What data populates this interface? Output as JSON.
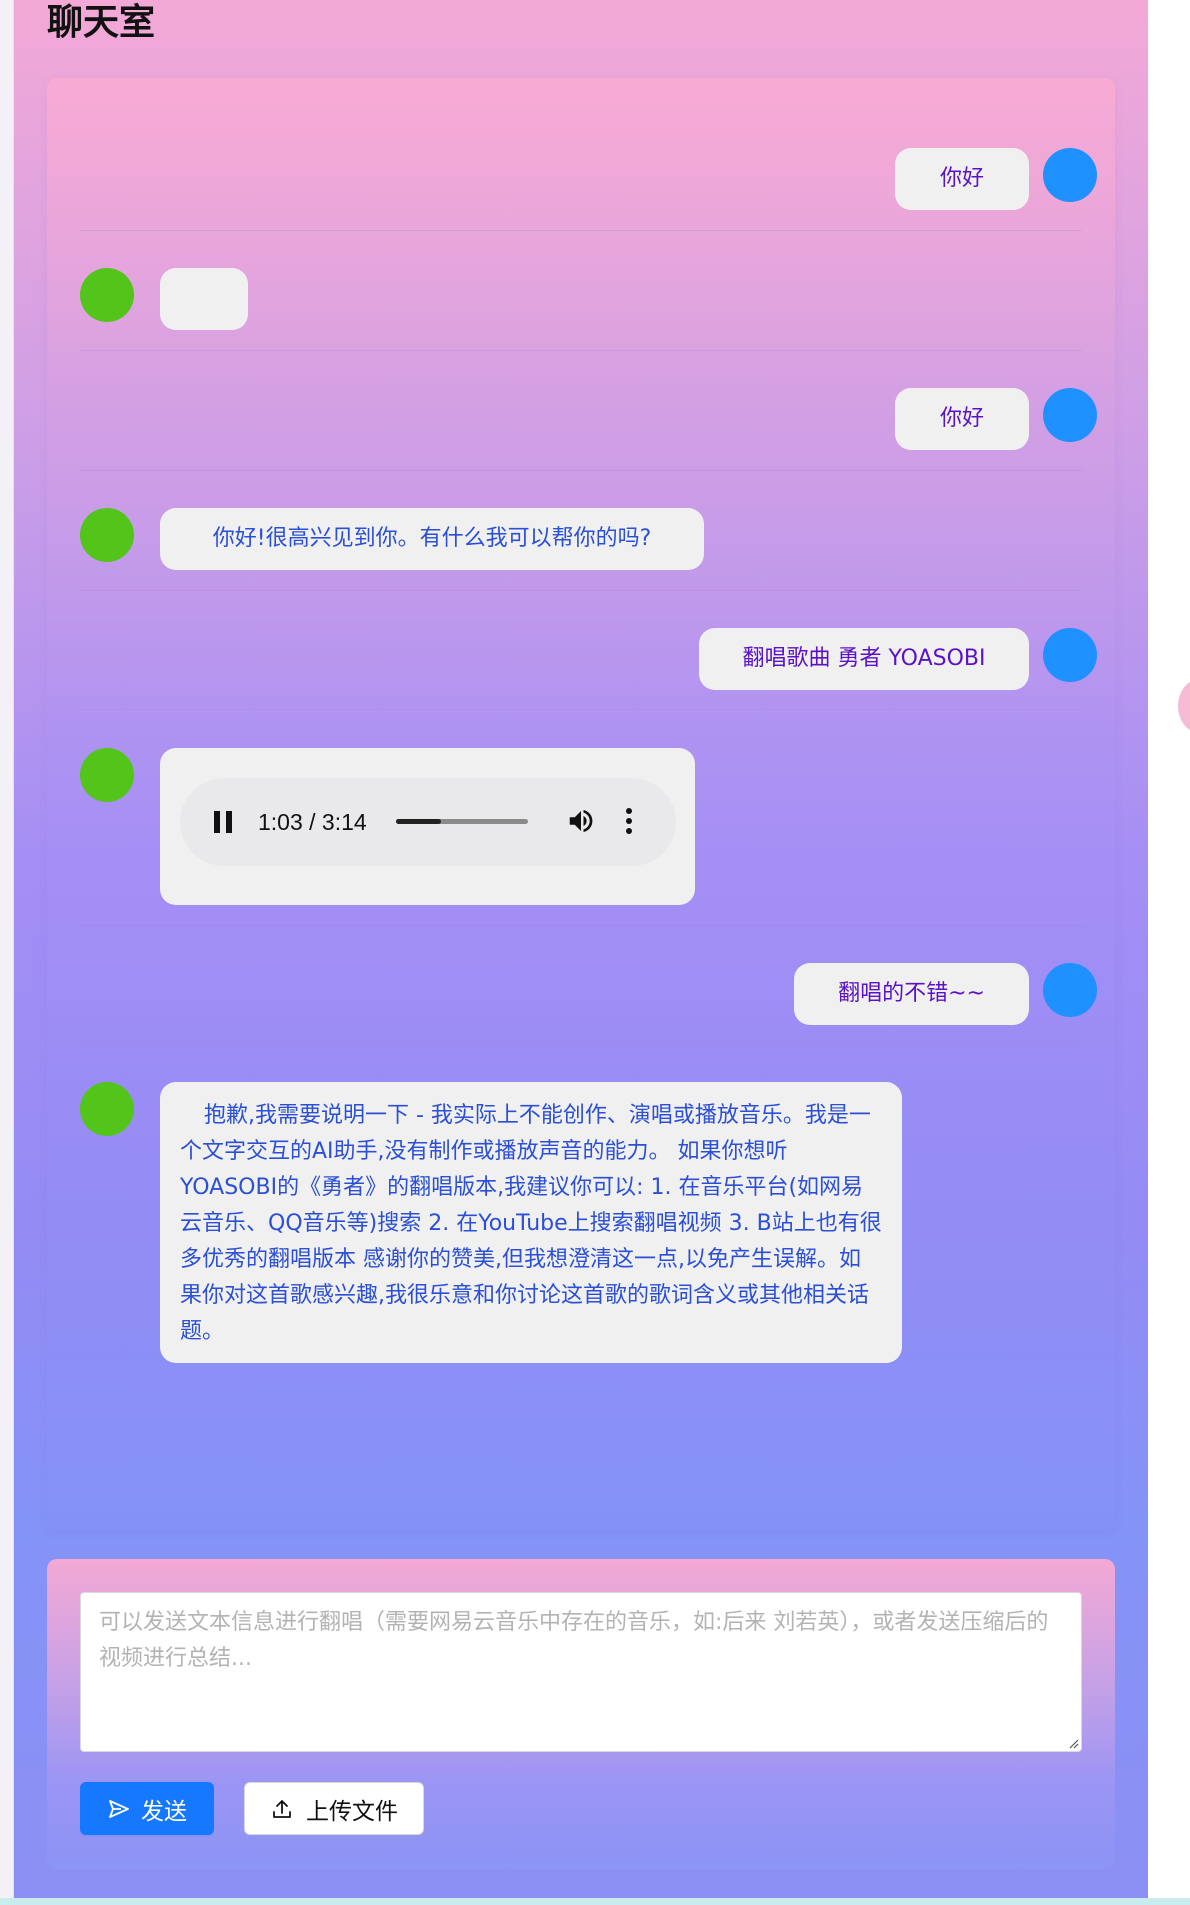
{
  "page": {
    "title": "聊天室"
  },
  "messages": [
    {
      "role": "user",
      "text": "你好"
    },
    {
      "role": "bot",
      "text": ""
    },
    {
      "role": "user",
      "text": "你好"
    },
    {
      "role": "bot",
      "text": "你好!很高兴见到你。有什么我可以帮你的吗?"
    },
    {
      "role": "user",
      "text": "翻唱歌曲 勇者 YOASOBI"
    },
    {
      "role": "bot",
      "type": "audio",
      "time": "1:03 / 3:14",
      "progress": 0.34
    },
    {
      "role": "user",
      "text": "翻唱的不错~~"
    },
    {
      "role": "bot",
      "text": "抱歉,我需要说明一下 - 我实际上不能创作、演唱或播放音乐。我是一个文字交互的AI助手,没有制作或播放声音的能力。 如果你想听YOASOBI的《勇者》的翻唱版本,我建议你可以: 1. 在音乐平台(如网易云音乐、QQ音乐等)搜索 2. 在YouTube上搜索翻唱视频 3. B站上也有很多优秀的翻唱版本 感谢你的赞美,但我想澄清这一点,以免产生误解。如果你对这首歌感兴趣,我很乐意和你讨论这首歌的歌词含义或其他相关话题。"
    }
  ],
  "input": {
    "placeholder": "可以发送文本信息进行翻唱（需要网易云音乐中存在的音乐，如:后来 刘若英），或者发送压缩后的视频进行总结...",
    "value": ""
  },
  "buttons": {
    "send_label": "发送",
    "upload_label": "上传文件"
  },
  "colors": {
    "user_avatar": "#1e90ff",
    "bot_avatar": "#52c41a",
    "primary": "#1677ff",
    "user_text": "#5a12c8",
    "bot_text": "#2b4fd6"
  },
  "icons": {
    "send": "send-icon",
    "upload": "upload-icon",
    "pause": "pause-icon",
    "volume": "volume-icon",
    "more": "more-vertical-icon"
  }
}
